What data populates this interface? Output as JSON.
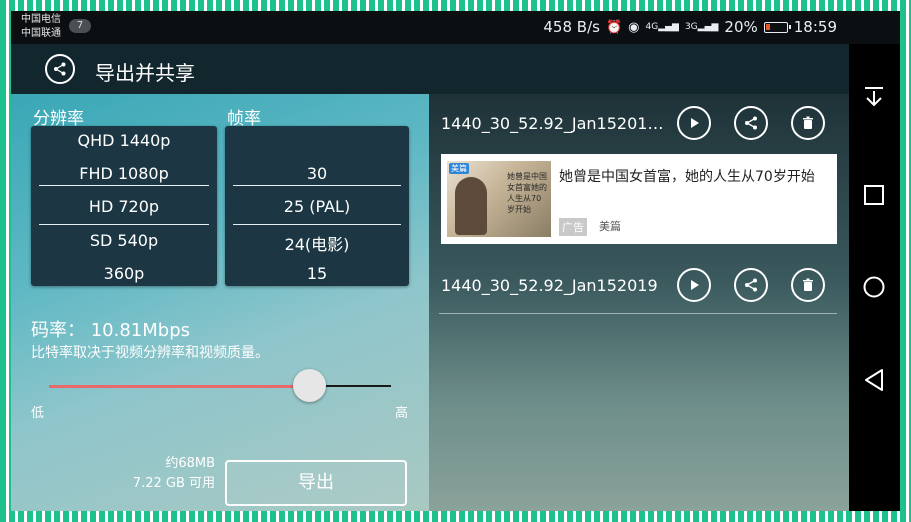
{
  "status_bar": {
    "carrier_1": "中国电信",
    "carrier_2": "中国联通",
    "notification_count": "7",
    "net_speed": "458 B/s",
    "signal_1": "4G",
    "signal_2": "3G",
    "battery": "20%",
    "battery_level": 0.2,
    "time": "18:59"
  },
  "app_bar": {
    "title": "导出并共享"
  },
  "export_settings": {
    "resolution_label": "分辨率",
    "resolution_options": [
      "QHD 1440p",
      "FHD 1080p",
      "HD 720p",
      "SD 540p",
      "360p"
    ],
    "framerate_label": "帧率",
    "framerate_options": [
      "",
      "30",
      "25 (PAL)",
      "24(电影)",
      "15"
    ],
    "bitrate_text": "码率： 10.81Mbps",
    "bitrate_desc": "比特率取决于视频分辨率和视频质量。",
    "slider_level": 0.76,
    "slider_low": "低",
    "slider_high": "高",
    "size_estimate": "约68MB",
    "storage_available": "7.22 GB 可用",
    "export_button": "导出"
  },
  "exports": {
    "items": [
      {
        "name": "1440_30_52.92_Jan15201…"
      },
      {
        "name": "1440_30_52.92_Jan152019"
      }
    ],
    "ad": {
      "title": "她曾是中国女首富，她的人生从70岁开始",
      "tag": "广告",
      "source": "美篇",
      "thumb_logo": "美篇",
      "thumb_text": "她曾是中国女首富她的人生从70岁开始"
    }
  },
  "colors": {
    "accent_red": "#e86a6a",
    "battery_red": "#e65a2b",
    "border_green": "#1ec08e"
  }
}
